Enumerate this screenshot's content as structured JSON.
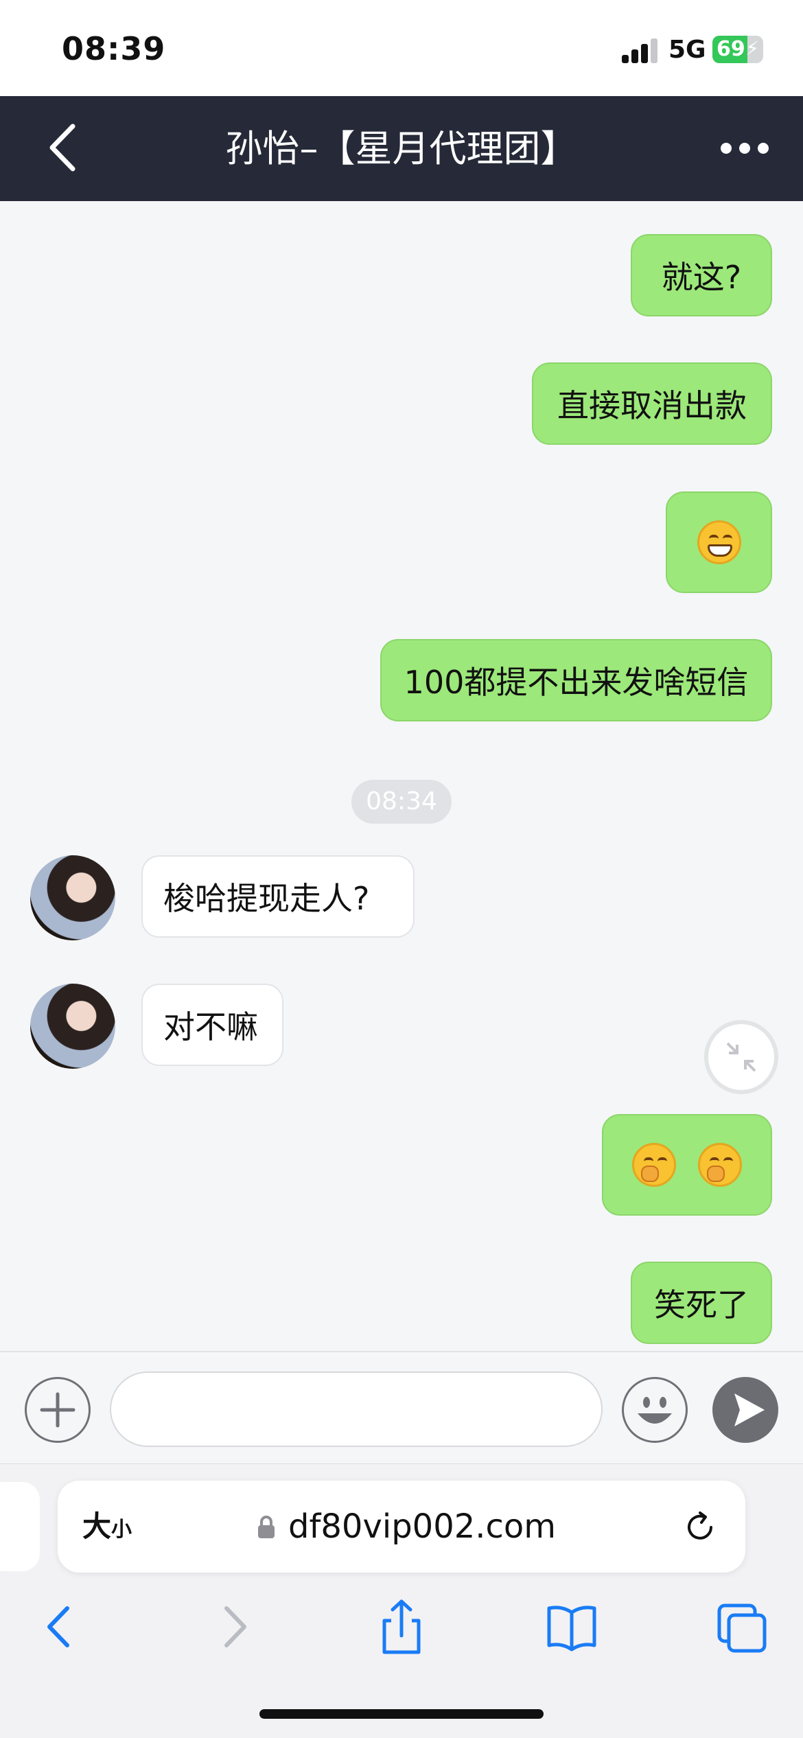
{
  "status_bar": {
    "time": "08:39",
    "network": "5G",
    "battery": "69",
    "battery_fraction": 0.69
  },
  "header": {
    "title": "孙怡–【星月代理团】",
    "back_icon": "chevron-left-icon",
    "more_icon": "ellipsis-icon"
  },
  "messages": [
    {
      "direction": "out",
      "text": "就这?"
    },
    {
      "direction": "out",
      "text": "直接取消出款"
    },
    {
      "direction": "out",
      "emoji": [
        "grinning-face-icon"
      ]
    },
    {
      "direction": "out",
      "text": "100都提不出来发啥短信"
    },
    {
      "direction": "in",
      "text": "梭哈提现走人?"
    },
    {
      "direction": "in",
      "text": "对不嘛"
    },
    {
      "direction": "out",
      "emoji": [
        "face-with-hand-over-mouth-icon",
        "face-with-hand-over-mouth-icon"
      ]
    },
    {
      "direction": "out",
      "text": "笑死了"
    }
  ],
  "timestamp": "08:34",
  "input": {
    "value": "",
    "placeholder": ""
  },
  "browser": {
    "text_size_big": "大",
    "text_size_small": "小",
    "url": "df80vip002.com"
  },
  "colors": {
    "header_bg": "#262a38",
    "outgoing_bubble": "#9ce87a",
    "incoming_bubble": "#ffffff",
    "ios_blue": "#1a7cf5",
    "battery_green": "#34c759"
  }
}
